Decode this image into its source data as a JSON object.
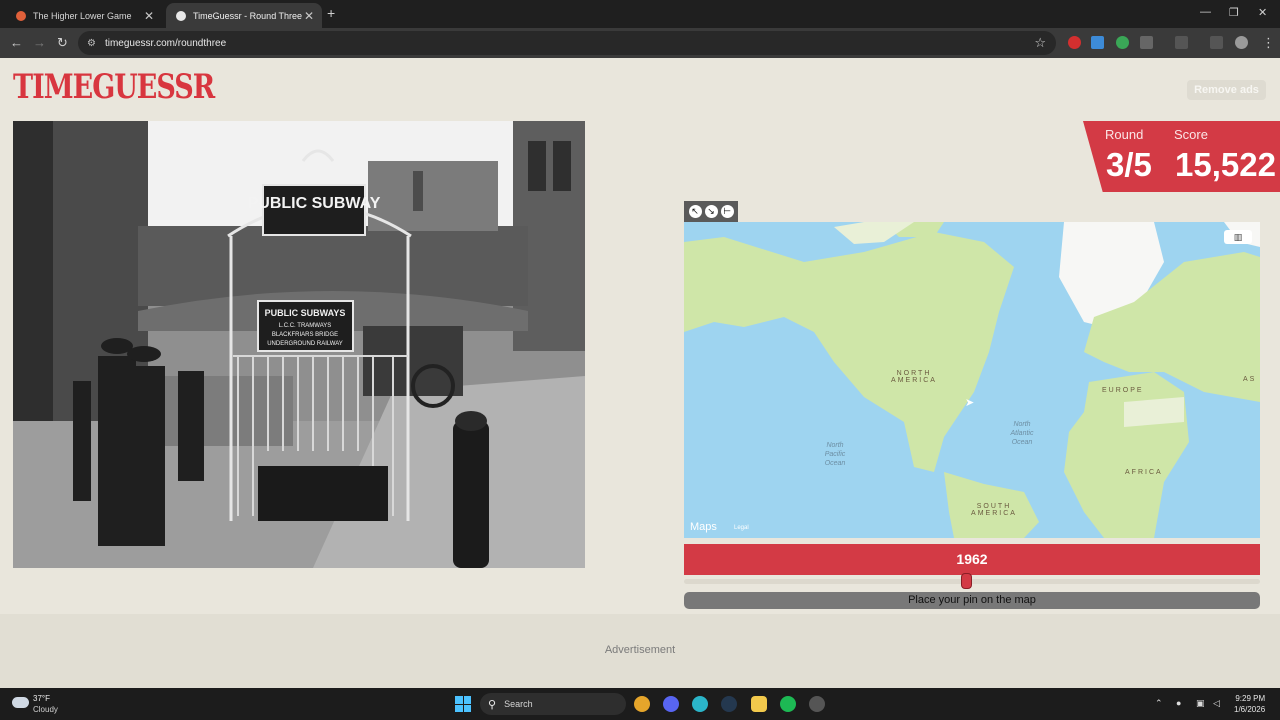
{
  "browser": {
    "tabs": [
      {
        "title": "The Higher Lower Game",
        "active": false
      },
      {
        "title": "TimeGuessr - Round Three",
        "active": true
      }
    ],
    "url": "timeguessr.com/roundthree"
  },
  "header": {
    "logo_text": "TIMEGUESSR",
    "remove_ads_label": "Remove ads"
  },
  "photo": {
    "sign_top": "PUBLIC SUBWAY",
    "sign_lines": [
      "PUBLIC SUBWAYS",
      "L.C.C. TRAMWAYS",
      "BLACKFRIARS BRIDGE",
      "UNDERGROUND RAILWAY"
    ]
  },
  "scoreboard": {
    "round_label": "Round",
    "round_value": "3/5",
    "score_label": "Score",
    "score_value": "15,522"
  },
  "map": {
    "labels": {
      "north_america": "NORTH AMERICA",
      "south_america": "SOUTH AMERICA",
      "europe": "EUROPE",
      "africa": "AFRICA",
      "asia_partial": "AS",
      "north_pacific": "North Pacific Ocean",
      "north_atlantic": "North Atlantic Ocean"
    },
    "brand": "Maps",
    "legal": "Legal"
  },
  "year_guess": "1962",
  "year_slider_fraction": 0.49,
  "place_pin_label": "Place your pin on the map",
  "ad_label": "Advertisement",
  "taskbar": {
    "weather_temp": "37°F",
    "weather_cond": "Cloudy",
    "search_label": "Search",
    "time": "9:29 PM",
    "date": "1/6/2026"
  },
  "colors": {
    "brand_red": "#d33a45",
    "page_bg": "#e9e6dc",
    "ocean": "#9ed4f0",
    "land": "#cfe6a8"
  }
}
